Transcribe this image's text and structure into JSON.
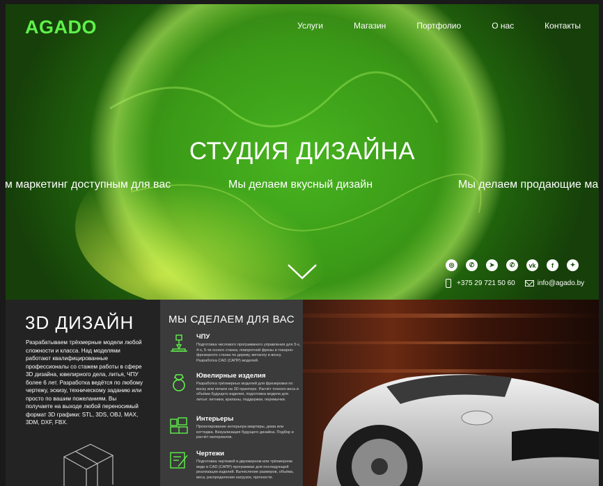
{
  "header": {
    "logo": "AGADO",
    "nav": [
      "Услуги",
      "Магазин",
      "Портфолио",
      "О нас",
      "Контакты"
    ]
  },
  "hero": {
    "title": "СТУДИЯ ДИЗАЙНА",
    "slogans": [
      "ем маркетинг доступным для вас",
      "Мы делаем вкусный дизайн",
      "Мы делаем продающие ма"
    ]
  },
  "socials": [
    {
      "name": "instagram-icon",
      "glyph": "◎"
    },
    {
      "name": "viber-icon",
      "glyph": "✆"
    },
    {
      "name": "telegram-icon",
      "glyph": "➤"
    },
    {
      "name": "whatsapp-icon",
      "glyph": "✆"
    },
    {
      "name": "vk-icon",
      "glyph": "vk"
    },
    {
      "name": "facebook-icon",
      "glyph": "f"
    },
    {
      "name": "twitter-icon",
      "glyph": "✦"
    }
  ],
  "contacts": {
    "phone": "+375 29 721 50 60",
    "email": "info@agado.by"
  },
  "design3d": {
    "title": "3D ДИЗАЙН",
    "description": "Разрабатываем трёхмерные модели любой сложности и класса. Над моделями работают квалифицированные профессионалы со стажем работы в сфере 3D дизайна, ювелирного дела, литья, ЧПУ более 6 лет. Разработка ведётся по любому чертежу, эскизу, техническому заданию или просто по вашим пожеланиям. Вы получаете на выходе любой переносимый формат 3D графики: STL, 3DS, OBJ, MAX, 3DM, DXF, FBX."
  },
  "services": {
    "title": "МЫ СДЕЛАЕМ ДЛЯ ВАС",
    "items": [
      {
        "name": "ЧПУ",
        "icon": "cnc-icon",
        "text": "Подготовка числового программного управления для 3-х, 4-х, 5-ти осного станка, поворотной фрезы и токарно-фрезерного станка по дереву, металлу и воску. Разработка CAD (САПР) моделей."
      },
      {
        "name": "Ювелирные изделия",
        "icon": "ring-icon",
        "text": "Разработка трёхмерных моделей для фрезеровки по воску или печати на 3D принтере. Расчёт точного веса и объёма будущего изделия, подготовка модели для литья: литники, крапаны, поддержки, перемычки."
      },
      {
        "name": "Интерьеры",
        "icon": "interior-icon",
        "text": "Проектирование интерьера квартиры, дома или коттеджа. Визуализация будущего дизайна. Подбор и расчёт материалов."
      },
      {
        "name": "Чертежи",
        "icon": "drawing-icon",
        "text": "Подготовка чертежей в двухмерном или трёхмерном виде в CAD (САПР) программах для последующей реализации изделий. Вычисление размеров, объёма, веса, распределения нагрузок, прочности."
      }
    ]
  },
  "colors": {
    "accent": "#5ff24a",
    "hero_green": "#2b8a10",
    "dark_panel": "#232323",
    "mid_panel": "#3b3b3b"
  }
}
